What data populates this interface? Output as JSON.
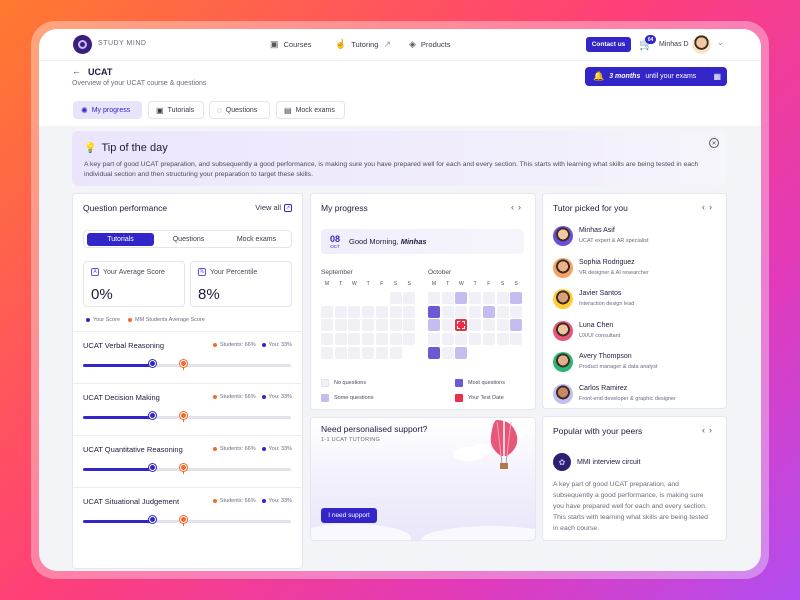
{
  "brand": {
    "name": "STUDY MIND"
  },
  "nav": {
    "courses": "Courses",
    "tutoring": "Tutoring",
    "products": "Products",
    "contact": "Contact us",
    "cart_count": "04",
    "user_name": "Minhas D"
  },
  "header": {
    "title": "UCAT",
    "subtitle": "Overview of your UCAT course & questions",
    "exam_highlight": "3 months",
    "exam_text": "until your exams"
  },
  "tabs": [
    {
      "label": "My progress",
      "active": true
    },
    {
      "label": "Tutorials"
    },
    {
      "label": "Questions"
    },
    {
      "label": "Mock exams"
    }
  ],
  "tip": {
    "title": "Tip of the day",
    "text": "A key part of good UCAT preparation, and subsequently a good performance, is making sure you have prepared well for each and every section. This starts with learning what skills are being tested in each individual section and then structuring your preparation to target these skills."
  },
  "question_performance": {
    "title": "Question performance",
    "view_all": "View all",
    "segments": [
      "Tutorials",
      "Questions",
      "Mock exams"
    ],
    "avg_label": "Your Average Score",
    "avg_value": "0%",
    "pct_label": "Your Percentile",
    "pct_value": "8%",
    "legend_you": "Your Score",
    "legend_students": "MM Students Average Score",
    "subjects": [
      {
        "name": "UCAT Verbal Reasoning",
        "students": "Students: 66%",
        "you": "You: 33%",
        "you_frac": 0.33,
        "students_frac": 0.48
      },
      {
        "name": "UCAT Decision Making",
        "students": "Students: 66%",
        "you": "You: 33%",
        "you_frac": 0.33,
        "students_frac": 0.48
      },
      {
        "name": "UCAT Quantitative Reasoning",
        "students": "Students: 66%",
        "you": "You: 33%",
        "you_frac": 0.33,
        "students_frac": 0.48
      },
      {
        "name": "UCAT Situational Judgement",
        "students": "Students: 66%",
        "you": "You: 33%",
        "you_frac": 0.33,
        "students_frac": 0.48
      }
    ]
  },
  "progress": {
    "title": "My progress",
    "date_day": "08",
    "date_month": "OCT",
    "greeting": "Good Morning,",
    "greeting_name": "Minhas",
    "months": [
      "September",
      "October"
    ],
    "weekdays": [
      "M",
      "T",
      "W",
      "T",
      "F",
      "S",
      "S"
    ],
    "legend": {
      "none": "No questions",
      "most": "Most questions",
      "some": "Some questions",
      "test": "Your Test Date"
    },
    "colors": {
      "none": "#f0f0f6",
      "some": "#c3bdf0",
      "most": "#6b5ad6",
      "test": "#e8304a"
    }
  },
  "support": {
    "title": "Need personalised support?",
    "subtitle": "1-1 UCAT TUTORING",
    "button": "I need support"
  },
  "tutors": {
    "title": "Tutor picked for you",
    "items": [
      {
        "name": "Minhas Asif",
        "role": "UCAT expert & AR specialist"
      },
      {
        "name": "Sophia Rodriguez",
        "role": "VR designer & AI researcher"
      },
      {
        "name": "Javier Santos",
        "role": "Interaction design lead"
      },
      {
        "name": "Luna Chen",
        "role": "UX/UI consultant"
      },
      {
        "name": "Avery Thompson",
        "role": "Product manager & data analyst"
      },
      {
        "name": "Carlos Ramirez",
        "role": "Front-end developer & graphic designer"
      }
    ]
  },
  "peers": {
    "title": "Popular with your peers",
    "item": "MMI interview circuit",
    "text": "A key part of good UCAT preparation, and subsequently a good performance, is making sure you have prepared well for each and every section. This starts with learning what skills are being tested in each course."
  },
  "colors": {
    "accent": "#3226c9",
    "orange": "#f26b2a"
  }
}
